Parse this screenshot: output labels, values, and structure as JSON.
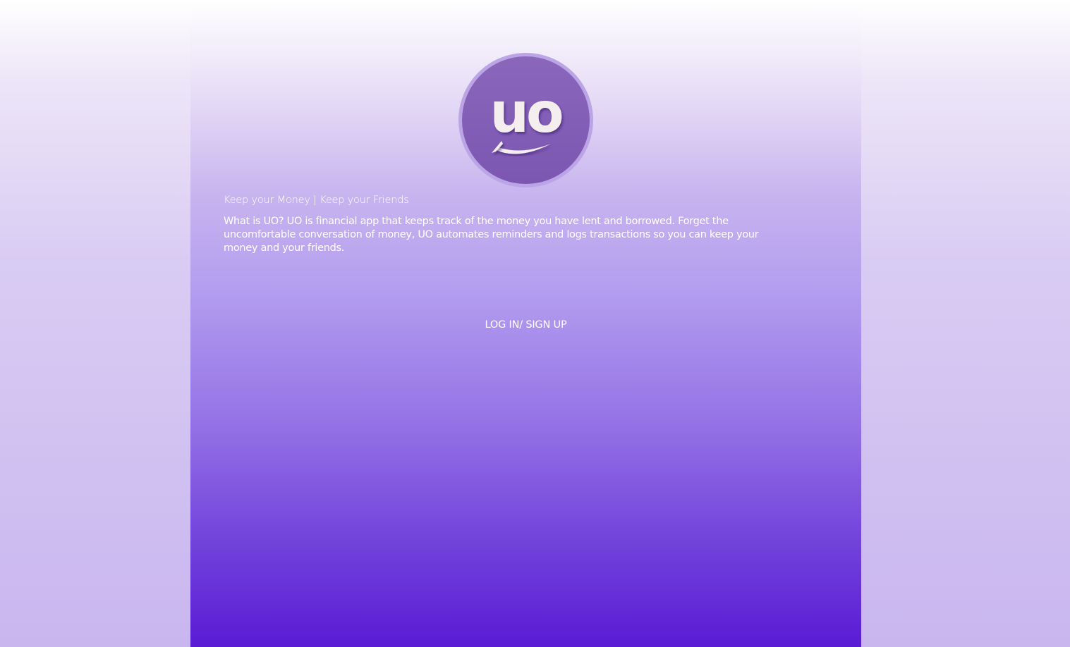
{
  "logo": {
    "text": "uo",
    "icon": "uo-smile-logo-icon",
    "colors": {
      "ring": "#bba5e6",
      "fill": "#8a67bb",
      "letters": "#f5eeee"
    }
  },
  "tagline": "Keep your Money | Keep your Friends",
  "description": "What is UO? UO is financial app that keeps track of the money you have lent and borrowed. Forget the uncomfortable conversation of money, UO automates reminders and logs transactions so you can keep your money and your friends.",
  "login_link": "LOG IN/ SIGN UP",
  "colors": {
    "gradient_top": "#ffffff",
    "gradient_bottom": "#5a1bd4",
    "text": "#ffffff"
  }
}
